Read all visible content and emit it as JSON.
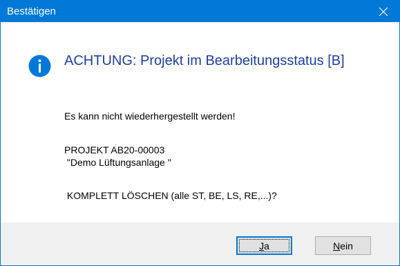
{
  "window": {
    "title": "Bestätigen"
  },
  "message": {
    "heading": "ACHTUNG: Projekt im Bearbeitungsstatus [B]",
    "line1": "Es kann nicht wiederhergestellt werden!",
    "line2": "PROJEKT AB20-00003",
    "line3": " \"Demo Lüftungsanlage \"",
    "line4": " KOMPLETT LÖSCHEN (alle ST, BE, LS, RE,...)?"
  },
  "buttons": {
    "yes": {
      "mnemonic": "J",
      "rest": "a"
    },
    "no": {
      "mnemonic": "N",
      "rest": "ein"
    }
  },
  "colors": {
    "titlebar": "#0078d7",
    "heading": "#1e3f9e",
    "icon": "#0078d7"
  }
}
